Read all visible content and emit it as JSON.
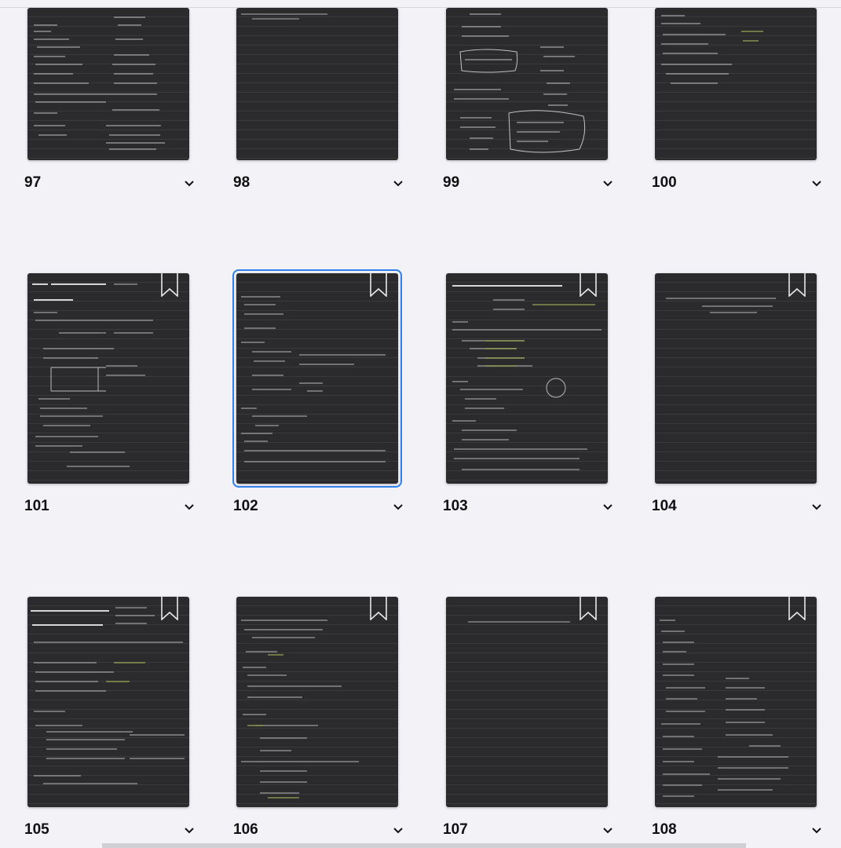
{
  "pages": [
    {
      "number": "97",
      "bookmarked": false,
      "selected": false
    },
    {
      "number": "98",
      "bookmarked": false,
      "selected": false
    },
    {
      "number": "99",
      "bookmarked": false,
      "selected": false
    },
    {
      "number": "100",
      "bookmarked": false,
      "selected": false
    },
    {
      "number": "101",
      "bookmarked": true,
      "selected": false
    },
    {
      "number": "102",
      "bookmarked": true,
      "selected": true
    },
    {
      "number": "103",
      "bookmarked": true,
      "selected": false
    },
    {
      "number": "104",
      "bookmarked": true,
      "selected": false
    },
    {
      "number": "105",
      "bookmarked": true,
      "selected": false
    },
    {
      "number": "106",
      "bookmarked": true,
      "selected": false
    },
    {
      "number": "107",
      "bookmarked": true,
      "selected": false
    },
    {
      "number": "108",
      "bookmarked": true,
      "selected": false
    }
  ],
  "colors": {
    "background": "#f2f2f7",
    "page": "#2b2b2d",
    "ink": "#e8e8e8",
    "highlight_ink": "#d8e86a",
    "selection": "#2f80ed"
  },
  "icons": {
    "expand": "chevron-down-icon",
    "bookmark": "bookmark-icon"
  }
}
